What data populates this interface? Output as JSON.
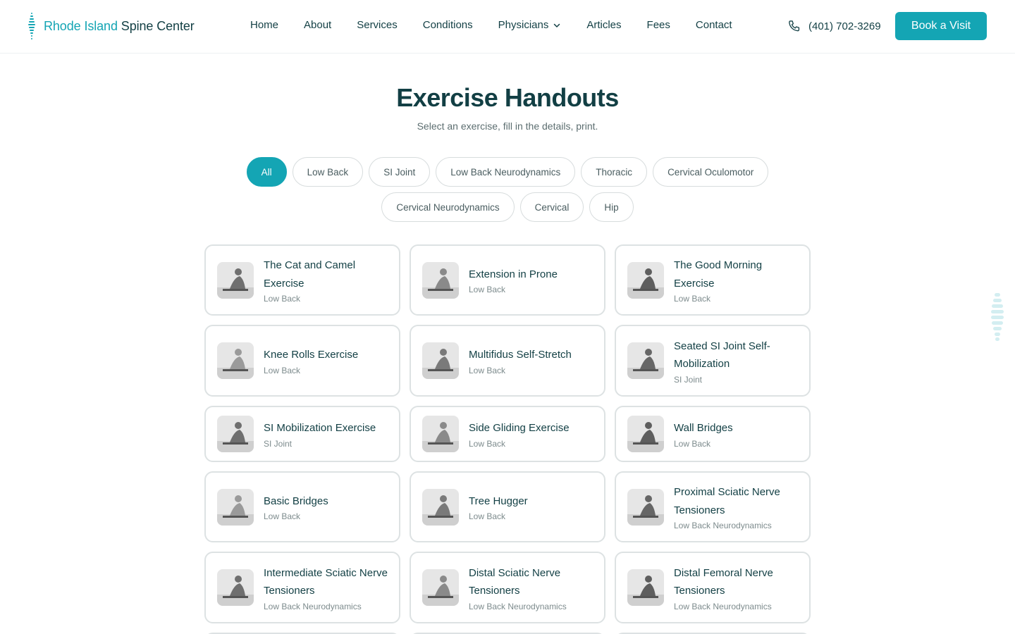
{
  "brand": {
    "name_part1": "Rhode Island",
    "name_part2": "Spine Center",
    "accent": "#14a5b4",
    "text_color": "#123f44"
  },
  "nav": {
    "items": [
      {
        "label": "Home"
      },
      {
        "label": "About"
      },
      {
        "label": "Services"
      },
      {
        "label": "Conditions"
      },
      {
        "label": "Physicians",
        "has_dropdown": true
      },
      {
        "label": "Articles"
      },
      {
        "label": "Fees"
      },
      {
        "label": "Contact"
      }
    ],
    "phone": "(401) 702-3269",
    "phone_icon": "phone-icon",
    "cta_label": "Book a Visit"
  },
  "page": {
    "title": "Exercise Handouts",
    "subtitle": "Select an exercise, fill in the details, print."
  },
  "filters": {
    "selected": "All",
    "options": [
      "All",
      "Low Back",
      "SI Joint",
      "Low Back Neurodynamics",
      "Thoracic",
      "Cervical Oculomotor",
      "Cervical Neurodynamics",
      "Cervical",
      "Hip"
    ]
  },
  "exercises": [
    {
      "title": "The Cat and Camel Exercise",
      "category": "Low Back"
    },
    {
      "title": "Extension in Prone",
      "category": "Low Back"
    },
    {
      "title": "The Good Morning Exercise",
      "category": "Low Back"
    },
    {
      "title": "Knee Rolls Exercise",
      "category": "Low Back"
    },
    {
      "title": "Multifidus Self-Stretch",
      "category": "Low Back"
    },
    {
      "title": "Seated SI Joint Self-Mobilization",
      "category": "SI Joint"
    },
    {
      "title": "SI Mobilization Exercise",
      "category": "SI Joint"
    },
    {
      "title": "Side Gliding Exercise",
      "category": "Low Back"
    },
    {
      "title": "Wall Bridges",
      "category": "Low Back"
    },
    {
      "title": "Basic Bridges",
      "category": "Low Back"
    },
    {
      "title": "Tree Hugger",
      "category": "Low Back"
    },
    {
      "title": "Proximal Sciatic Nerve Tensioners",
      "category": "Low Back Neurodynamics"
    },
    {
      "title": "Intermediate Sciatic Nerve Tensioners",
      "category": "Low Back Neurodynamics"
    },
    {
      "title": "Distal Sciatic Nerve Tensioners",
      "category": "Low Back Neurodynamics"
    },
    {
      "title": "Distal Femoral Nerve Tensioners",
      "category": "Low Back Neurodynamics"
    },
    {
      "title": "",
      "category": ""
    },
    {
      "title": "",
      "category": ""
    },
    {
      "title": "",
      "category": ""
    }
  ]
}
